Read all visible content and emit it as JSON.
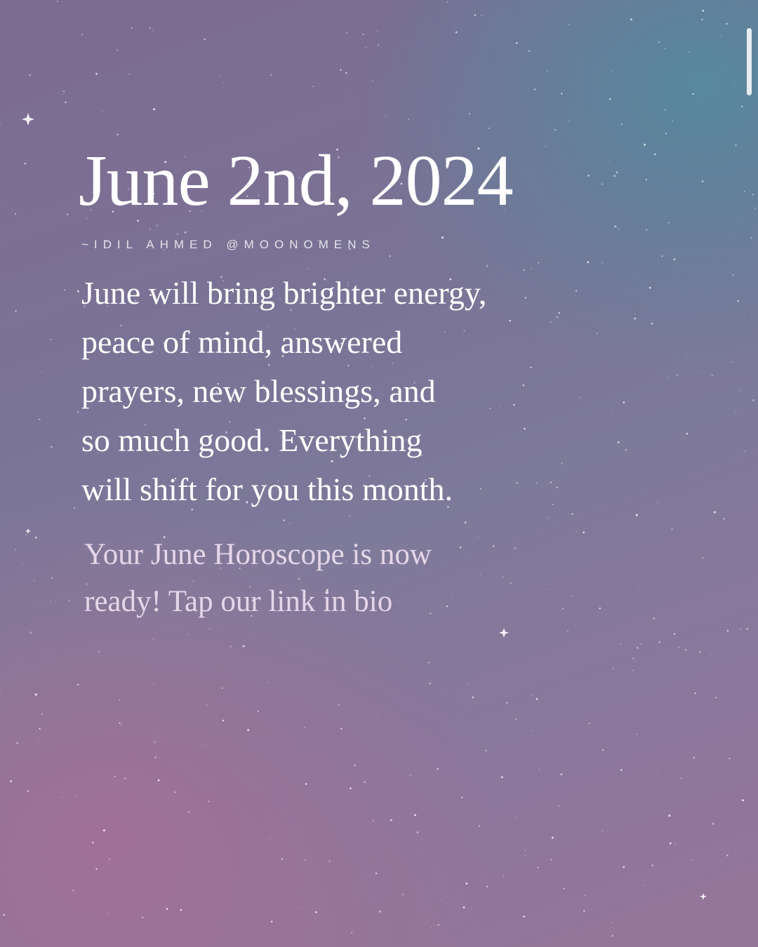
{
  "post": {
    "title": "June 2nd, 2024",
    "byline": "~IDIL AHMED @MOONOMENS",
    "message_lines": [
      "June will bring brighter energy,",
      "peace of mind, answered",
      "prayers, new blessings, and",
      "so much good. Everything",
      "will shift for you this month."
    ],
    "cta_lines": [
      "Your June Horoscope is now",
      "ready! Tap our link in bio"
    ]
  },
  "colors": {
    "teal": "#508ca0",
    "mauve": "#aa6e96",
    "text": "#ffffff"
  }
}
